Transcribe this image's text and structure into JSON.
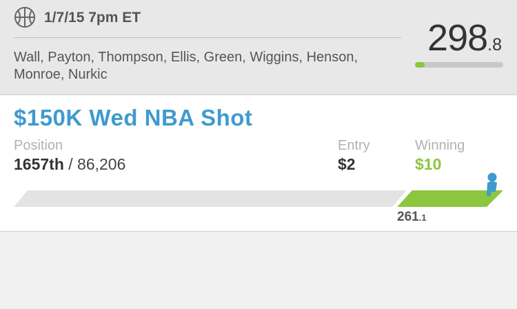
{
  "header": {
    "game_time": "1/7/15 7pm ET",
    "icon": "basketball-icon",
    "players": "Wall, Payton, Thompson, Ellis, Green, Wiggins, Henson, Monroe, Nurkic",
    "score_main": "298",
    "score_decimal": ".8",
    "score_progress": 0.11
  },
  "contest": {
    "name": "$150K Wed NBA Shot",
    "position_label": "Position",
    "rank": "1657th",
    "separator": " / ",
    "total_entries": "86,206",
    "entry_label": "Entry",
    "entry_value": "$2",
    "winning_label": "Winning",
    "winning_value": "$10",
    "current_score_main": "261",
    "current_score_decimal": ".1",
    "user_icon": "person-marker-icon"
  },
  "colors": {
    "accent_blue": "#3f9bce",
    "accent_green": "#8cc63f",
    "track_gray": "#e3e3e3"
  }
}
